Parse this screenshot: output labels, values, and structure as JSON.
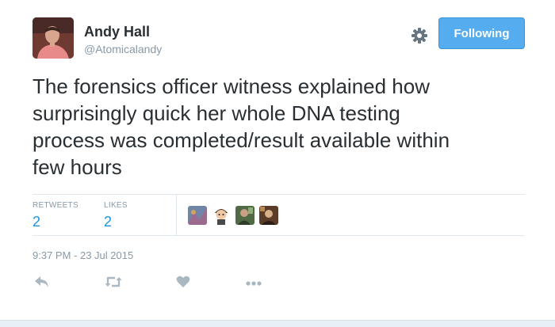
{
  "author": {
    "name": "Andy Hall",
    "handle": "@Atomicalandy"
  },
  "follow_button": {
    "label": "Following"
  },
  "tweet": {
    "text_lines": [
      "The forensics officer witness explained how",
      "surprisingly quick her whole DNA testing",
      "process was completed/result available within",
      "few hours"
    ]
  },
  "stats": {
    "retweets": {
      "label": "RETWEETS",
      "count": "2"
    },
    "likes": {
      "label": "LIKES",
      "count": "2"
    }
  },
  "timestamp": "9:37 PM - 23 Jul 2015",
  "icons": {
    "settings": "gear-icon",
    "reply": "reply-icon",
    "retweet": "retweet-icon",
    "like": "heart-icon",
    "more": "more-icon"
  },
  "colors": {
    "accent": "#55acee",
    "count": "#1b95e0",
    "muted": "#8899a6",
    "icon": "#aab8c2",
    "text": "#292f33"
  }
}
